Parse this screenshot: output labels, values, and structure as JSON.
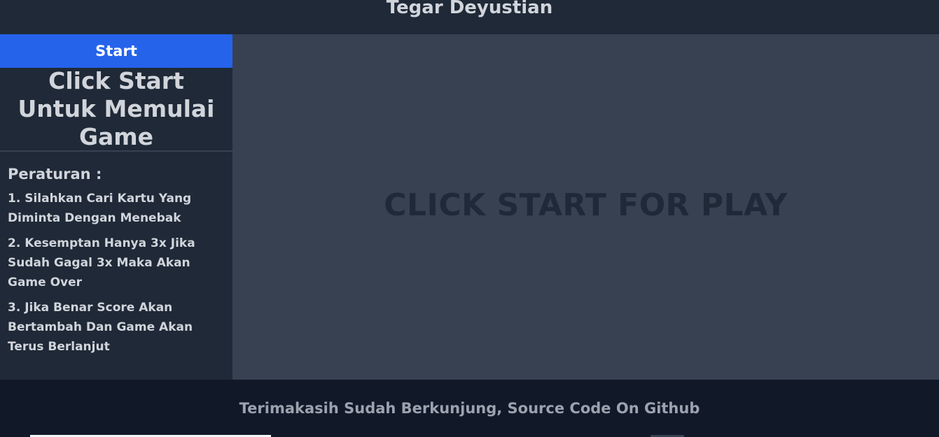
{
  "header": {
    "title": "Tegar Deyustian"
  },
  "sidebar": {
    "start_label": "Start",
    "status_text": "Click Start Untuk Memulai Game",
    "rules_title": "Peraturan :",
    "rules": [
      "1. Silahkan Cari Kartu Yang Diminta Dengan Menebak",
      "2. Kesemptan Hanya 3x Jika Sudah Gagal 3x Maka Akan Game Over",
      "3. Jika Benar Score Akan Bertambah Dan Game Akan Terus Berlanjut"
    ]
  },
  "main": {
    "message": "CLICK START FOR PLAY"
  },
  "footer": {
    "text": "Terimakasih Sudah Berkunjung, Source Code On Github"
  },
  "colors": {
    "accent": "#2563eb",
    "header_bg": "#1f2937",
    "main_bg": "#374151",
    "footer_bg": "#111827"
  }
}
